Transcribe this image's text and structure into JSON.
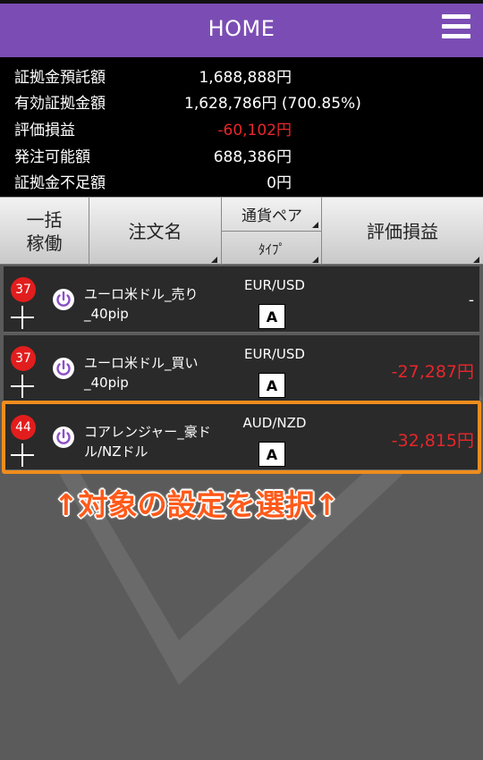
{
  "header": {
    "title": "HOME",
    "menu_icon": "hamburger-menu-icon"
  },
  "summary": [
    {
      "label": "証拠金預託額",
      "value": "1,688,888円"
    },
    {
      "label": "有効証拠金額",
      "value": "1,628,786円 (700.85%)"
    },
    {
      "label": "評価損益",
      "value": "-60,102円"
    },
    {
      "label": "発注可能額",
      "value": "688,386円"
    },
    {
      "label": "証拠金不足額",
      "value": "0円"
    }
  ],
  "table_header": {
    "col1": "一括\n稼働",
    "col2": "注文名",
    "col3_top": "通貨ペア",
    "col3_bottom": "ﾀｲﾌﾟ",
    "col4": "評価損益"
  },
  "rows": [
    {
      "badge": "37",
      "name": "ユーロ米ドル_売り_40pip",
      "pair": "EUR/USD",
      "type": "A",
      "pl": "-"
    },
    {
      "badge": "37",
      "name": "ユーロ米ドル_買い_40pip",
      "pair": "EUR/USD",
      "type": "A",
      "pl": "-27,287円"
    },
    {
      "badge": "44",
      "name": "コアレンジャー_豪ドル/NZドル",
      "pair": "AUD/NZD",
      "type": "A",
      "pl": "-32,815円"
    }
  ],
  "caption": "↑対象の設定を選択↑",
  "colors": {
    "header": "#7b4db4",
    "negative": "#e8262a",
    "badge": "#e21d1d",
    "highlight": "#f08d1d",
    "power": "#8b4fc8"
  }
}
